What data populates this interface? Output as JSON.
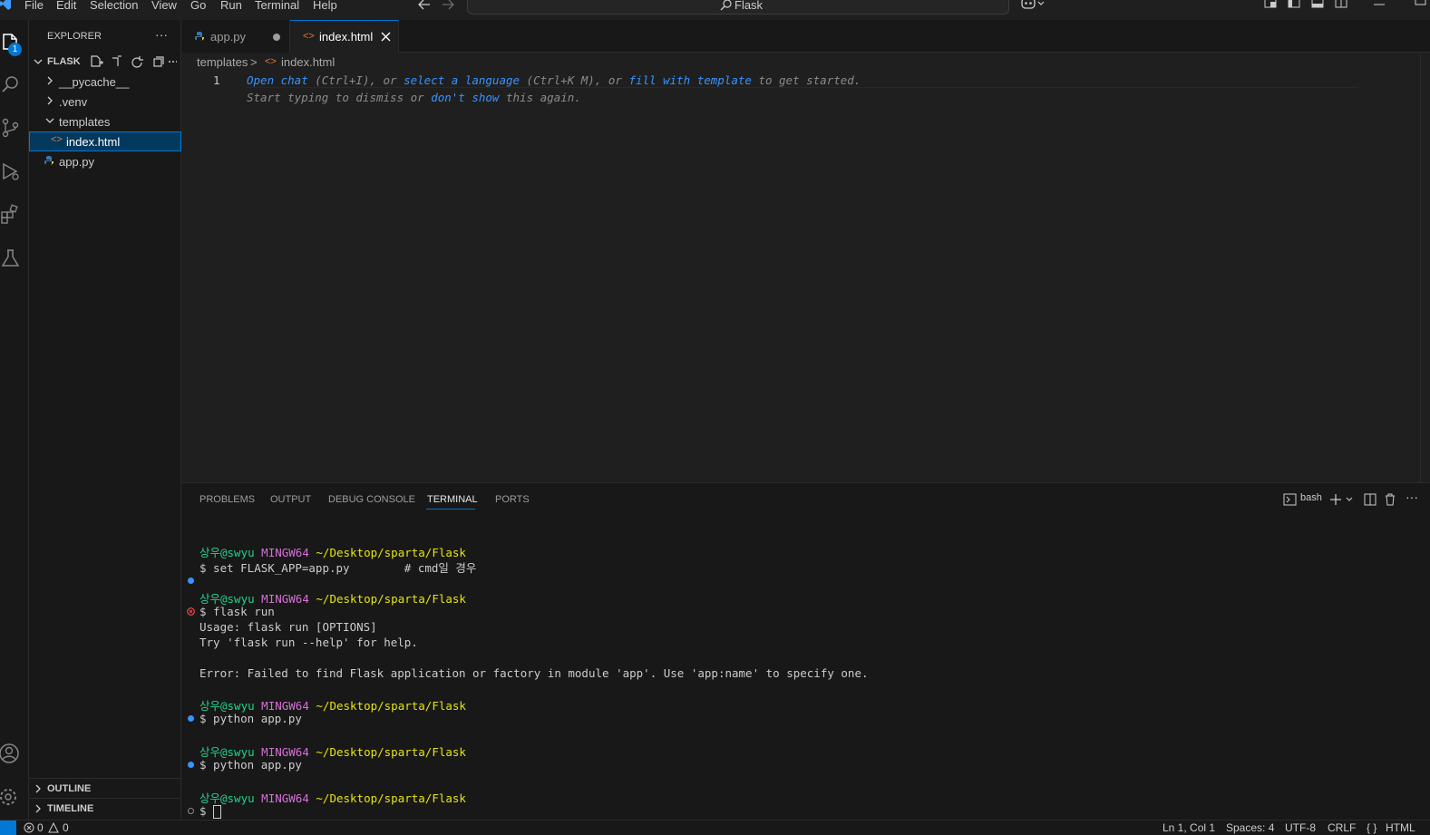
{
  "menu": [
    "File",
    "Edit",
    "Selection",
    "View",
    "Go",
    "Run",
    "Terminal",
    "Help"
  ],
  "command_center": {
    "label": "Flask"
  },
  "activity_bar": {
    "explorer_badge": "1"
  },
  "sidebar": {
    "title": "EXPLORER",
    "more": "···",
    "root": "FLASK",
    "items": [
      {
        "label": "__pycache__"
      },
      {
        "label": ".venv"
      },
      {
        "label": "templates"
      },
      {
        "label": "index.html"
      },
      {
        "label": "app.py"
      }
    ],
    "outline": "OUTLINE",
    "timeline": "TIMELINE"
  },
  "tabs": [
    {
      "label": "app.py",
      "modified": true
    },
    {
      "label": "index.html",
      "active": true
    }
  ],
  "breadcrumb": {
    "folder": "templates",
    "file": "index.html",
    "sep": ">"
  },
  "editor": {
    "line_number": "1",
    "hint1": {
      "a": "Open chat",
      "b": " (Ctrl+I), or ",
      "c": "select a language",
      "d": " (Ctrl+K M), or ",
      "e": "fill with template",
      "f": " to get started."
    },
    "hint2": {
      "a": "Start typing to dismiss or ",
      "b": "don't show",
      "c": " this again."
    }
  },
  "panel": {
    "tabs": [
      "PROBLEMS",
      "OUTPUT",
      "DEBUG CONSOLE",
      "TERMINAL",
      "PORTS"
    ],
    "active_tab": "TERMINAL",
    "shell": "bash",
    "more": "···"
  },
  "terminal": {
    "user": "상우@swyu",
    "host": "MINGW64",
    "path": "~/Desktop/sparta/Flask",
    "cmd1": "$ set FLASK_APP=app.py        # cmd일 경우",
    "cmd2": "$ flask run",
    "out1": "Usage: flask run [OPTIONS]",
    "out2": "Try 'flask run --help' for help.",
    "out3": "Error: Failed to find Flask application or factory in module 'app'. Use 'app:name' to specify one.",
    "cmd3": "$ python app.py",
    "cmd4": "$ python app.py",
    "cmd5": "$ "
  },
  "status": {
    "errors": "0",
    "warnings": "0",
    "position": "Ln 1, Col 1",
    "spaces": "Spaces: 4",
    "encoding": "UTF-8",
    "eol": "CRLF",
    "language": "HTML"
  },
  "colors": {
    "accent": "#0078d4",
    "prompt_user": "#23d18b",
    "prompt_host": "#d670d6",
    "prompt_path": "#e5e510"
  }
}
